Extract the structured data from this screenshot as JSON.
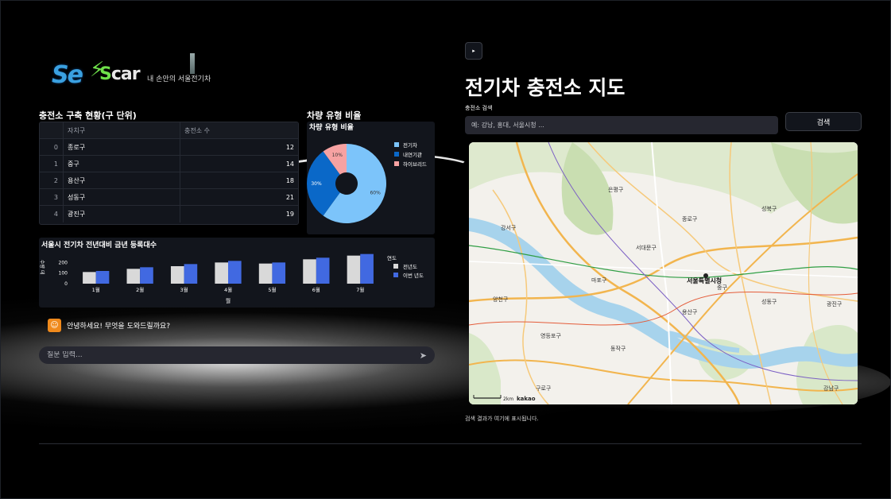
{
  "logo": {
    "mark": "Se",
    "car": "car",
    "car_s": "S",
    "tagline": "내 손안의 서울전기차"
  },
  "table_panel": {
    "title": "충전소 구축 현황(구 단위)",
    "columns": [
      "",
      "자치구",
      "충전소 수"
    ],
    "rows": [
      {
        "index": "0",
        "district": "종로구",
        "count": "12"
      },
      {
        "index": "1",
        "district": "중구",
        "count": "14"
      },
      {
        "index": "2",
        "district": "용산구",
        "count": "18"
      },
      {
        "index": "3",
        "district": "성동구",
        "count": "21"
      },
      {
        "index": "4",
        "district": "광진구",
        "count": "19"
      }
    ]
  },
  "pie_panel": {
    "outer_title": "차량 유형 비율"
  },
  "bar_panel": {
    "title": "서울시 전기차 전년대비 금년 등록대수"
  },
  "chart_data": [
    {
      "type": "pie",
      "title": "차량 유형 비율",
      "labels": [
        "전기차",
        "내연기관",
        "하이브리드"
      ],
      "values": [
        60,
        30,
        10
      ],
      "value_labels": [
        "60%",
        "30%",
        "10%"
      ],
      "colors": [
        "#7cc4fa",
        "#0a68c8",
        "#f7a2a2"
      ],
      "donut": true,
      "legend": "right"
    },
    {
      "type": "bar",
      "categories": [
        "1월",
        "2월",
        "3월",
        "4월",
        "5월",
        "6월",
        "7월"
      ],
      "series": [
        {
          "name": "전년도",
          "values": [
            110,
            140,
            165,
            200,
            190,
            230,
            265
          ],
          "color": "#d9d9d9"
        },
        {
          "name": "이번 년도",
          "values": [
            120,
            155,
            185,
            215,
            200,
            245,
            280
          ],
          "color": "#4169e1"
        }
      ],
      "xlabel": "월",
      "ylabel": "수량 데",
      "legend_title": "연도",
      "yticks": [
        0,
        100,
        200
      ],
      "ylim": [
        0,
        300
      ],
      "legend": "right"
    }
  ],
  "chat": {
    "avatar_icon": "robot-icon",
    "message": "안녕하세요! 무엇을 도와드릴까요?",
    "input_placeholder": "질문 입력...",
    "send_glyph": "➤"
  },
  "map_section": {
    "expander_glyph": "▸",
    "title": "전기차 충전소 지도",
    "search_label": "충전소 검색",
    "search_placeholder": "예: 강남, 홍대, 서울시청 ...",
    "search_button": "검색",
    "result_text": "검색 결과가 여기에 표시됩니다.",
    "scale_label": "2km",
    "provider": "kakao",
    "labels": {
      "seoul_city_hall": "서울특별시청",
      "seodaemun": "서대문구",
      "jongno": "종로구",
      "seongbuk": "성북구",
      "eunpyeong": "은평구",
      "mapo": "마포구",
      "yongsan": "용산구",
      "junggu": "중구",
      "seongdong": "성동구",
      "gwangjin": "광진구",
      "dongjak": "동작구",
      "yeongdeungpo": "영등포구",
      "gangnam": "강남구",
      "guro": "구로구",
      "yangcheon": "양천구",
      "gangseo": "강서구"
    }
  }
}
